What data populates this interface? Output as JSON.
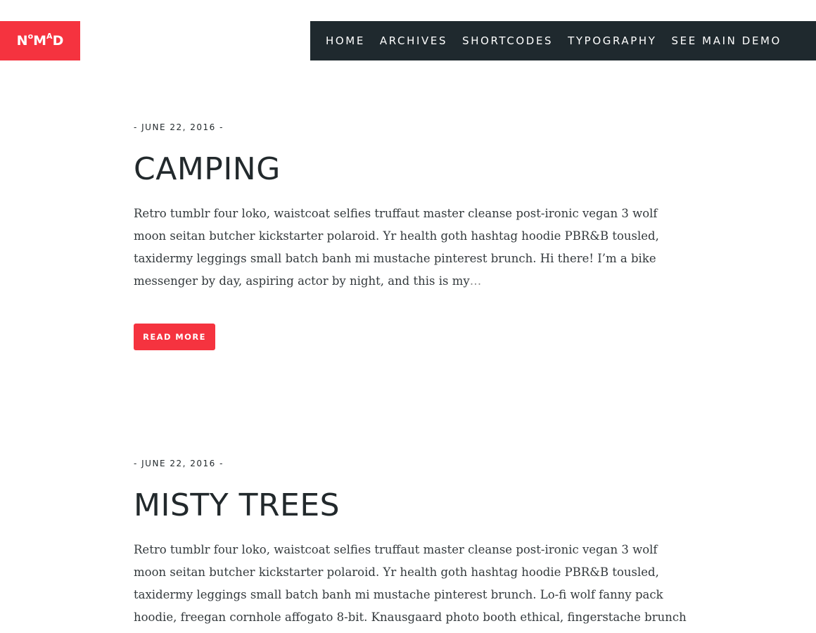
{
  "logo": {
    "letters": [
      "N",
      "o",
      "M",
      "A",
      "D"
    ]
  },
  "nav": {
    "items": [
      {
        "label": "HOME"
      },
      {
        "label": "ARCHIVES"
      },
      {
        "label": "SHORTCODES"
      },
      {
        "label": "TYPOGRAPHY"
      },
      {
        "label": "SEE MAIN DEMO"
      }
    ]
  },
  "colors": {
    "accent": "#f5333f",
    "nav_background": "#1f292e",
    "text": "#22292c"
  },
  "posts": [
    {
      "date": "- JUNE 22, 2016 -",
      "title": "CAMPING",
      "excerpt": "Retro tumblr four loko, waistcoat selfies truffaut master cleanse post-ironic vegan 3 wolf moon seitan butcher kickstarter polaroid. Yr health goth hashtag hoodie PBR&B tousled, taxidermy leggings small batch banh mi mustache pinterest brunch. Hi there! I’m a bike messenger by day, aspiring actor by night, and this is my",
      "ellipsis": "…",
      "read_more": "READ MORE"
    },
    {
      "date": "- JUNE 22, 2016 -",
      "title": "MISTY TREES",
      "excerpt": "Retro tumblr four loko, waistcoat selfies truffaut master cleanse post-ironic vegan 3 wolf moon seitan butcher kickstarter polaroid. Yr health goth hashtag hoodie PBR&B tousled, taxidermy leggings small batch banh mi mustache pinterest brunch. Lo-fi wolf fanny pack hoodie, freegan cornhole affogato 8-bit. Knausgaard photo booth ethical, fingerstache brunch helvetica",
      "ellipsis": "…"
    }
  ]
}
